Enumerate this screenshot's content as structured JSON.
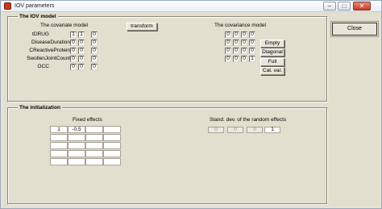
{
  "window": {
    "title": "IOV parameters",
    "buttons": {
      "minimize": "–",
      "maximize": "□",
      "close": "✕"
    }
  },
  "iov_panel": {
    "title": "The IOV model",
    "covariate_model_label": "The covariate model",
    "transform_label": "transform",
    "covariance_model_label": "The covariance model",
    "covariates": [
      {
        "name": "tDRUG",
        "values": [
          "1",
          "1",
          "0"
        ]
      },
      {
        "name": "DiseaseDuration",
        "values": [
          "0",
          "0",
          "0"
        ]
      },
      {
        "name": "CReactiveProtein",
        "values": [
          "0",
          "0",
          "0"
        ]
      },
      {
        "name": "SwollenJointCount",
        "values": [
          "0",
          "0",
          "0"
        ]
      },
      {
        "name": "OCC",
        "values": [
          "0",
          "0",
          "0"
        ]
      }
    ],
    "covariance_matrix": [
      [
        "0",
        "0",
        "0",
        "0"
      ],
      [
        "0",
        "0",
        "0",
        "0"
      ],
      [
        "0",
        "0",
        "0",
        "0"
      ],
      [
        "0",
        "0",
        "0",
        "1"
      ]
    ],
    "covariance_buttons": [
      "Empty",
      "Diagonal",
      "Full",
      "Cat. var."
    ]
  },
  "close_button": "Close",
  "init_panel": {
    "title": "The initialization",
    "fixed_effects_label": "Fixed effects",
    "fixed_effects": [
      [
        "1",
        "-0.5",
        "",
        ""
      ],
      [
        "",
        "",
        "",
        ""
      ],
      [
        "",
        "",
        "",
        ""
      ],
      [
        "",
        "",
        "",
        ""
      ],
      [
        "",
        "",
        "",
        ""
      ]
    ],
    "sd_label": "Stand. dev. of the random effects",
    "sd_values": [
      "0",
      "0",
      "0",
      "1"
    ]
  }
}
